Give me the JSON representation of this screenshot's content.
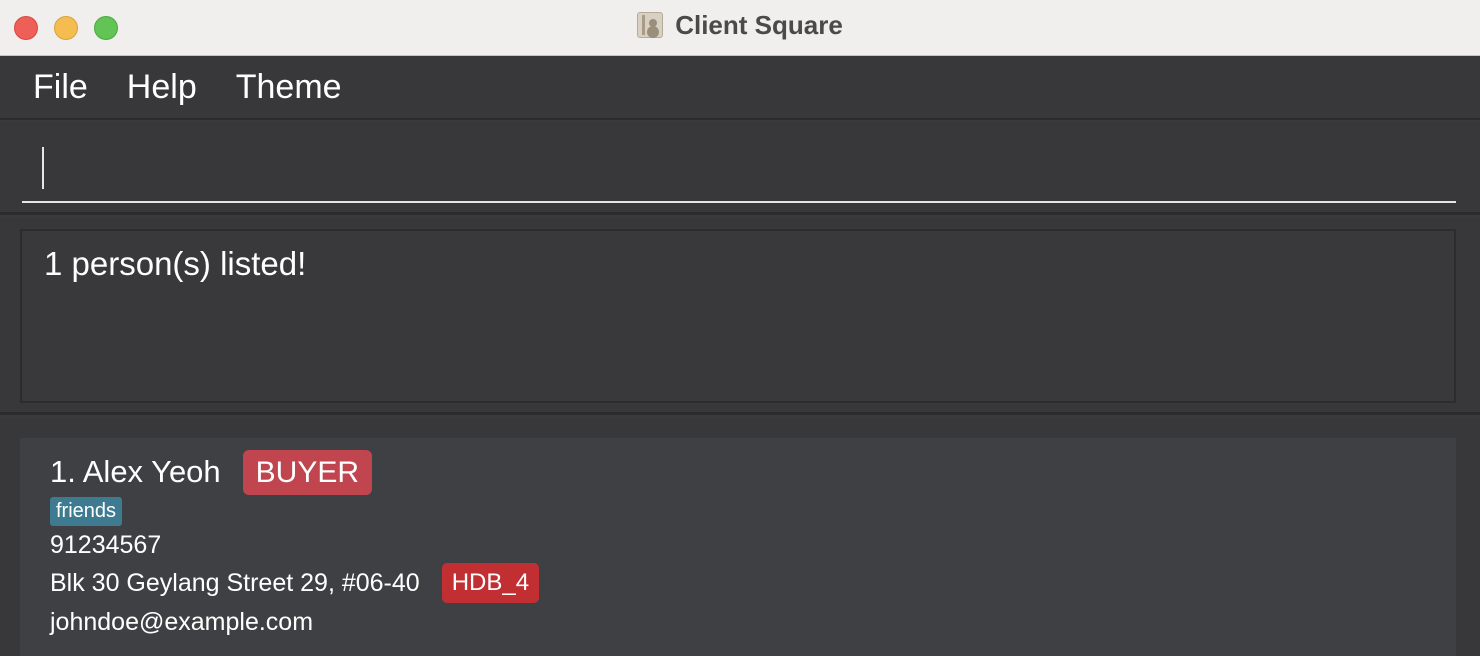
{
  "window": {
    "title": "Client Square"
  },
  "menu": [
    "File",
    "Help",
    "Theme"
  ],
  "command": {
    "value": ""
  },
  "result": {
    "message": "1 person(s) listed!"
  },
  "persons": [
    {
      "index_name": "1. Alex Yeoh",
      "role": "BUYER",
      "tags": [
        "friends"
      ],
      "phone": "91234567",
      "address": "Blk 30 Geylang Street 29, #06-40",
      "housing": "HDB_4",
      "email": "johndoe@example.com"
    }
  ],
  "colors": {
    "role_badge": "#c0454f",
    "housing_badge": "#c12f33",
    "tag": "#3e7b91",
    "background": "#38383a",
    "card": "#3f4043"
  }
}
